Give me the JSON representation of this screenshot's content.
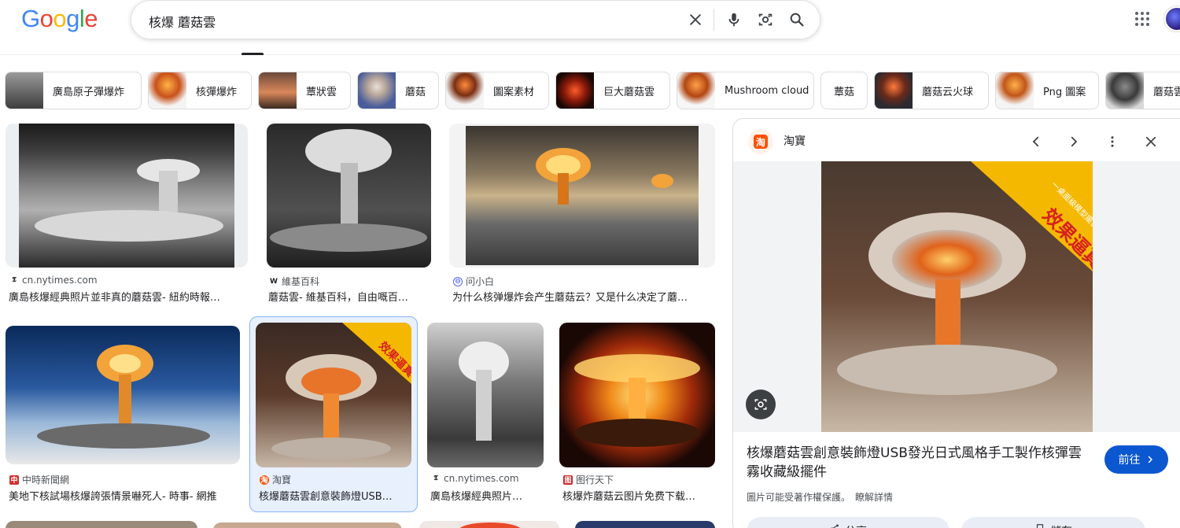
{
  "header": {
    "logo_letters": [
      "G",
      "o",
      "o",
      "g",
      "l",
      "e"
    ],
    "search_query": "核爆 蘑菇雲"
  },
  "chips": [
    {
      "label": "廣島原子彈爆炸",
      "thumb": "bw"
    },
    {
      "label": "核彈爆炸",
      "thumb": "fire"
    },
    {
      "label": "蕈狀雲",
      "thumb": "dusk"
    },
    {
      "label": "蘑菇",
      "thumb": "blue"
    },
    {
      "label": "圖案素材",
      "thumb": "fire"
    },
    {
      "label": "巨大蘑菇雲",
      "thumb": "red"
    },
    {
      "label": "Mushroom cloud",
      "thumb": "fire"
    },
    {
      "label": "蕈菇",
      "thumb": ""
    },
    {
      "label": "蘑菇云火球",
      "thumb": "dark"
    },
    {
      "label": "Png 圖案",
      "thumb": "fire"
    },
    {
      "label": "蘑菇雲",
      "thumb": "gray"
    }
  ],
  "results": [
    {
      "source": "cn.nytimes.com",
      "source_icon": "𝕿",
      "caption": "廣島核爆經典照片並非真的蘑菇雲- 紐約時報…",
      "thumb": "bw1"
    },
    {
      "source": "維基百科",
      "source_icon": "W",
      "caption": "蘑菇雲- 維基百科，自由嘅百…",
      "thumb": "bw2"
    },
    {
      "source": "问小白",
      "source_icon": "⊖",
      "caption": "为什么核弹爆炸会产生蘑菇云？又是什么决定了蘑…",
      "thumb": "city"
    },
    {
      "source": "中時新聞網",
      "source_icon": "中",
      "caption": "美地下核試場核爆誇張情景嚇死人- 時事- 網推",
      "thumb": "blue"
    },
    {
      "source": "淘寶",
      "source_icon": "淘",
      "caption": "核爆蘑菇雲創意裝飾燈USB…",
      "thumb": "lamp",
      "badge": "效果逼真"
    },
    {
      "source": "cn.nytimes.com",
      "source_icon": "𝕿",
      "caption": "廣島核爆經典照片…",
      "thumb": "bw3"
    },
    {
      "source": "图行天下",
      "source_icon": "图",
      "caption": "核爆炸蘑菇云图片免费下载…",
      "thumb": "orange"
    }
  ],
  "panel": {
    "site": "淘寶",
    "site_icon": "淘",
    "badge_text": "效果逼真",
    "badge_subtext": "一桌面級模型擺台一",
    "title": "核爆蘑菇雲創意裝飾燈USB發光日式風格手工製作核彈雲霧收藏級擺件",
    "visit_label": "前往",
    "copyright_note": "圖片可能受著作權保護。",
    "learn_more": "瞭解詳情",
    "share_label": "分享",
    "save_label": "儲存"
  },
  "colors": {
    "google_blue": "#4285F4",
    "google_red": "#EA4335",
    "google_yellow": "#FBBC05",
    "google_green": "#34A853",
    "accent": "#0b57d0",
    "taobao": "#ff5000"
  }
}
